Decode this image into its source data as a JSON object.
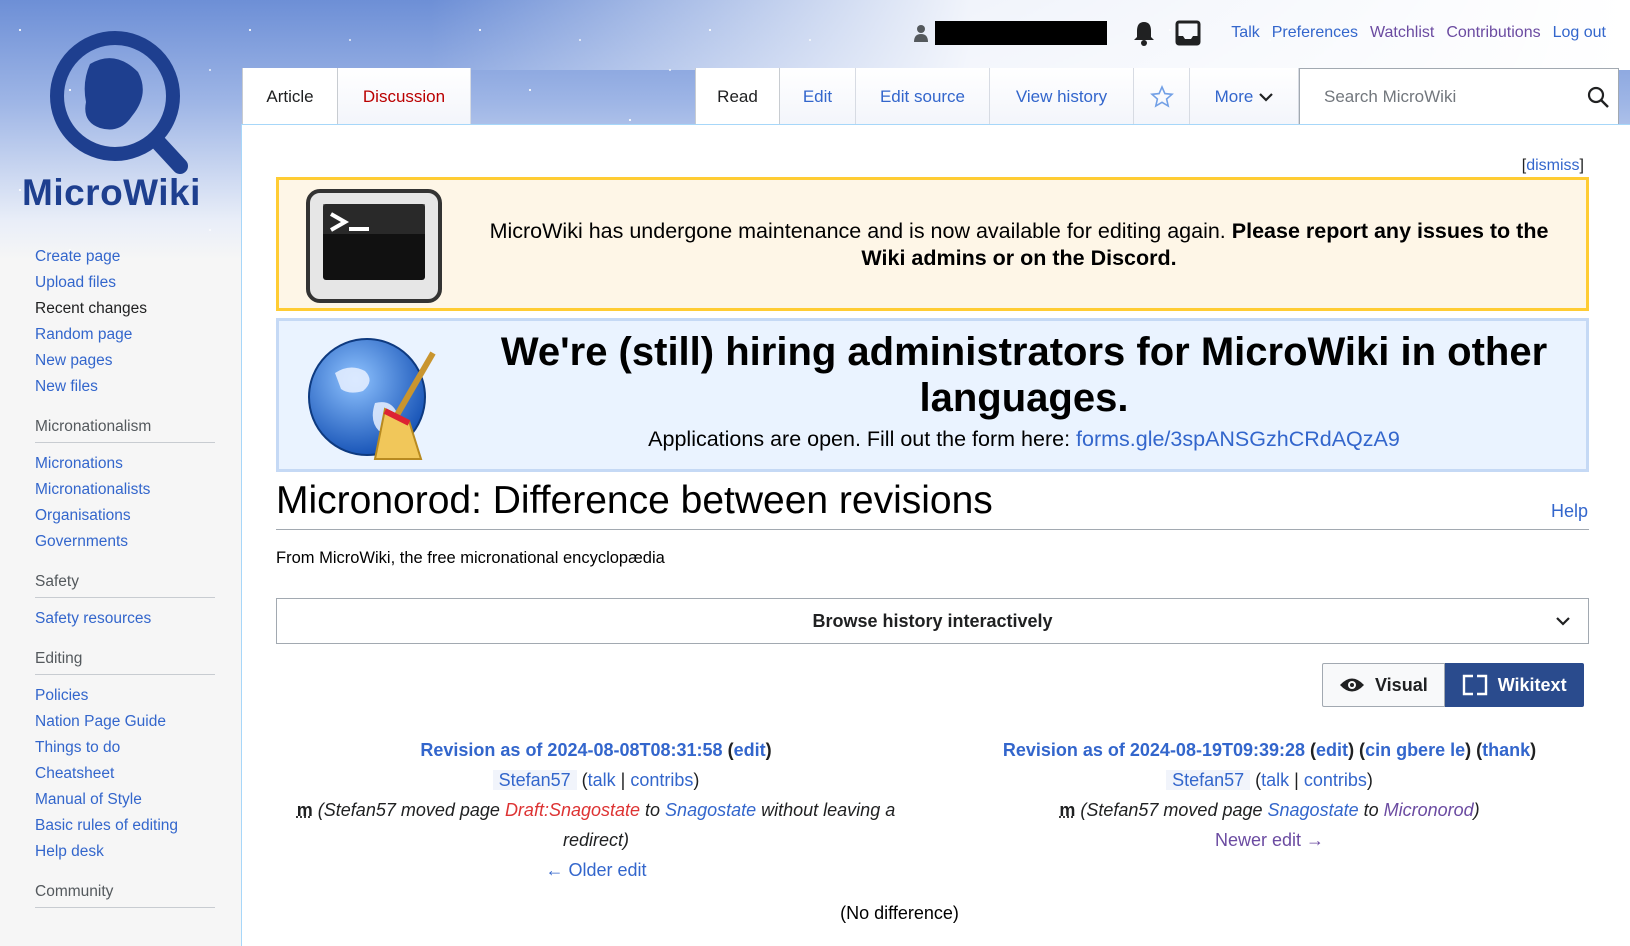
{
  "logo": {
    "text": "MicroWiki"
  },
  "personal": {
    "links": [
      "Talk",
      "Preferences",
      "Watchlist",
      "Contributions",
      "Log out"
    ]
  },
  "tabs": {
    "article": "Article",
    "discussion": "Discussion",
    "read": "Read",
    "edit": "Edit",
    "edit_source": "Edit source",
    "view_history": "View history",
    "more": "More"
  },
  "search": {
    "placeholder": "Search MicroWiki"
  },
  "sidebar": {
    "navigation": [
      "Create page",
      "Upload files",
      "Recent changes",
      "Random page",
      "New pages",
      "New files"
    ],
    "micronationalism": {
      "title": "Micronationalism",
      "items": [
        "Micronations",
        "Micronationalists",
        "Organisations",
        "Governments"
      ]
    },
    "safety": {
      "title": "Safety",
      "items": [
        "Safety resources"
      ]
    },
    "editing": {
      "title": "Editing",
      "items": [
        "Policies",
        "Nation Page Guide",
        "Things to do",
        "Cheatsheet",
        "Manual of Style",
        "Basic rules of editing",
        "Help desk"
      ]
    },
    "community": {
      "title": "Community"
    }
  },
  "notices": {
    "dismiss_open": "[",
    "dismiss": "dismiss",
    "dismiss_close": "]",
    "maintenance_text": "MicroWiki has undergone maintenance and is now available for editing again. ",
    "maintenance_bold": "Please report any issues to the Wiki admins or on the Discord.",
    "hiring_title": "We're (still) hiring administrators for MicroWiki in other languages.",
    "hiring_sub": "Applications are open. Fill out the form here: ",
    "hiring_link": "forms.gle/3spANSGzhCRdAQzA9"
  },
  "heading": {
    "title": "Micronorod: Difference between revisions",
    "help": "Help",
    "tagline": "From MicroWiki, the free micronational encyclopædia"
  },
  "browse": {
    "label": "Browse history interactively"
  },
  "switch": {
    "visual": "Visual",
    "wikitext": "Wikitext"
  },
  "diff": {
    "old": {
      "title": "Revision as of 2024-08-08T08:31:58",
      "edit": "edit",
      "user": "Stefan57",
      "talk": "talk",
      "contribs": "contribs",
      "minor": "m",
      "summary_pre": "(Stefan57 moved page ",
      "from_page": "Draft:Snagostate",
      "summary_mid": " to ",
      "to_page": "Snagostate",
      "summary_post": " without leaving a redirect)",
      "nav": "← Older edit"
    },
    "new": {
      "title": "Revision as of 2024-08-19T09:39:28",
      "edit": "edit",
      "undo": "cin gbere le",
      "thank": "thank",
      "user": "Stefan57",
      "talk": "talk",
      "contribs": "contribs",
      "minor": "m",
      "summary_pre": "(Stefan57 moved page ",
      "from_page": "Snagostate",
      "summary_mid": " to ",
      "to_page": "Micronorod",
      "summary_post": ")",
      "nav": "Newer edit →"
    },
    "no_difference": "(No difference)"
  }
}
